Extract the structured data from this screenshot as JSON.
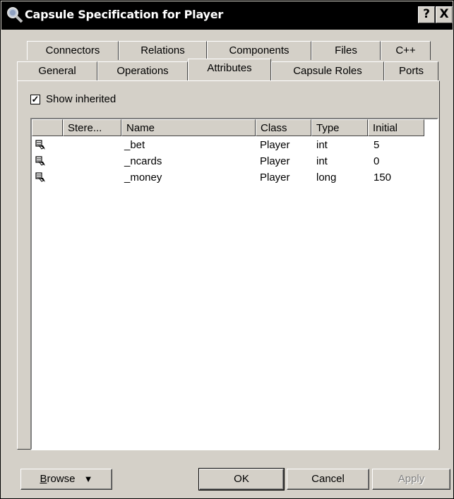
{
  "window": {
    "title": "Capsule Specification for Player",
    "help_label": "?",
    "close_label": "X"
  },
  "tabs_row1": [
    {
      "label": "Connectors"
    },
    {
      "label": "Relations"
    },
    {
      "label": "Components"
    },
    {
      "label": "Files"
    },
    {
      "label": "C++"
    }
  ],
  "tabs_row2": [
    {
      "label": "General"
    },
    {
      "label": "Operations"
    },
    {
      "label": "Attributes",
      "active": true
    },
    {
      "label": "Capsule Roles"
    },
    {
      "label": "Ports"
    }
  ],
  "show_inherited": {
    "label": "Show inherited",
    "checked": true
  },
  "table": {
    "columns": [
      "",
      "Stere...",
      "Name",
      "Class",
      "Type",
      "Initial"
    ],
    "rows": [
      {
        "icon": "attribute-icon",
        "stereotype": "",
        "name": "_bet",
        "class": "Player",
        "type": "int",
        "initial": "5"
      },
      {
        "icon": "attribute-icon",
        "stereotype": "",
        "name": "_ncards",
        "class": "Player",
        "type": "int",
        "initial": "0"
      },
      {
        "icon": "attribute-icon",
        "stereotype": "",
        "name": "_money",
        "class": "Player",
        "type": "long",
        "initial": "150"
      }
    ]
  },
  "buttons": {
    "browse_first": "B",
    "browse_rest": "rowse",
    "browse_arrow": "▼",
    "ok": "OK",
    "cancel": "Cancel",
    "apply": "Apply"
  }
}
